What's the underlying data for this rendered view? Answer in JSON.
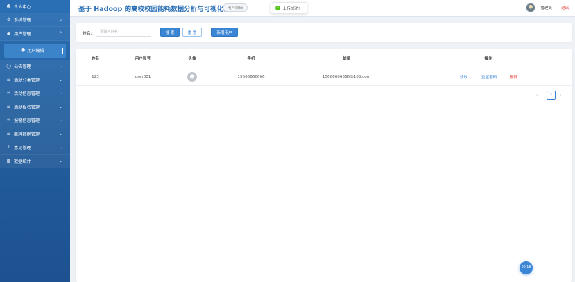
{
  "sidebar": {
    "items": [
      {
        "icon": "person-icon",
        "label": "个人中心"
      },
      {
        "icon": "gear-icon",
        "label": "系统管理"
      },
      {
        "icon": "users-icon",
        "label": "用户管理"
      },
      {
        "icon": "person-icon",
        "label": "用户编辑"
      },
      {
        "icon": "megaphone-icon",
        "label": "公告管理"
      },
      {
        "icon": "list-icon",
        "label": "活动分类管理"
      },
      {
        "icon": "list-icon",
        "label": "活动信息管理"
      },
      {
        "icon": "list-icon",
        "label": "活动报名管理"
      },
      {
        "icon": "list-icon",
        "label": "报警信息管理"
      },
      {
        "icon": "list-icon",
        "label": "能耗数据管理"
      },
      {
        "icon": "question-icon",
        "label": "意见管理"
      },
      {
        "icon": "chart-icon",
        "label": "数据统计"
      }
    ]
  },
  "header": {
    "title": "基于 Hadoop 的高校校园能耗数据分析与可视化系统",
    "breadcrumb": "用户编辑",
    "toast": "上传成功!",
    "user_name": "管理员",
    "logout": "退出"
  },
  "search": {
    "label": "姓名:",
    "placeholder": "请输入姓名",
    "search_btn": "搜 索",
    "reset_btn": "重 置",
    "add_btn": "新增用户"
  },
  "table": {
    "columns": [
      "姓名",
      "用户账号",
      "头像",
      "手机",
      "邮箱",
      "操作"
    ],
    "rows": [
      {
        "name": "123",
        "account": "user001",
        "phone": "15666666666",
        "email": "15666666666@163.com",
        "actions": [
          "修改",
          "重置密码",
          "删除"
        ]
      }
    ]
  },
  "pagination": {
    "current": "1",
    "prev": "‹",
    "next": "›"
  },
  "float_button": "00:18",
  "colors": {
    "primary": "#3a86d4",
    "sidebar": "#2a6fb5",
    "danger": "#e0352b",
    "success": "#52c41a"
  }
}
